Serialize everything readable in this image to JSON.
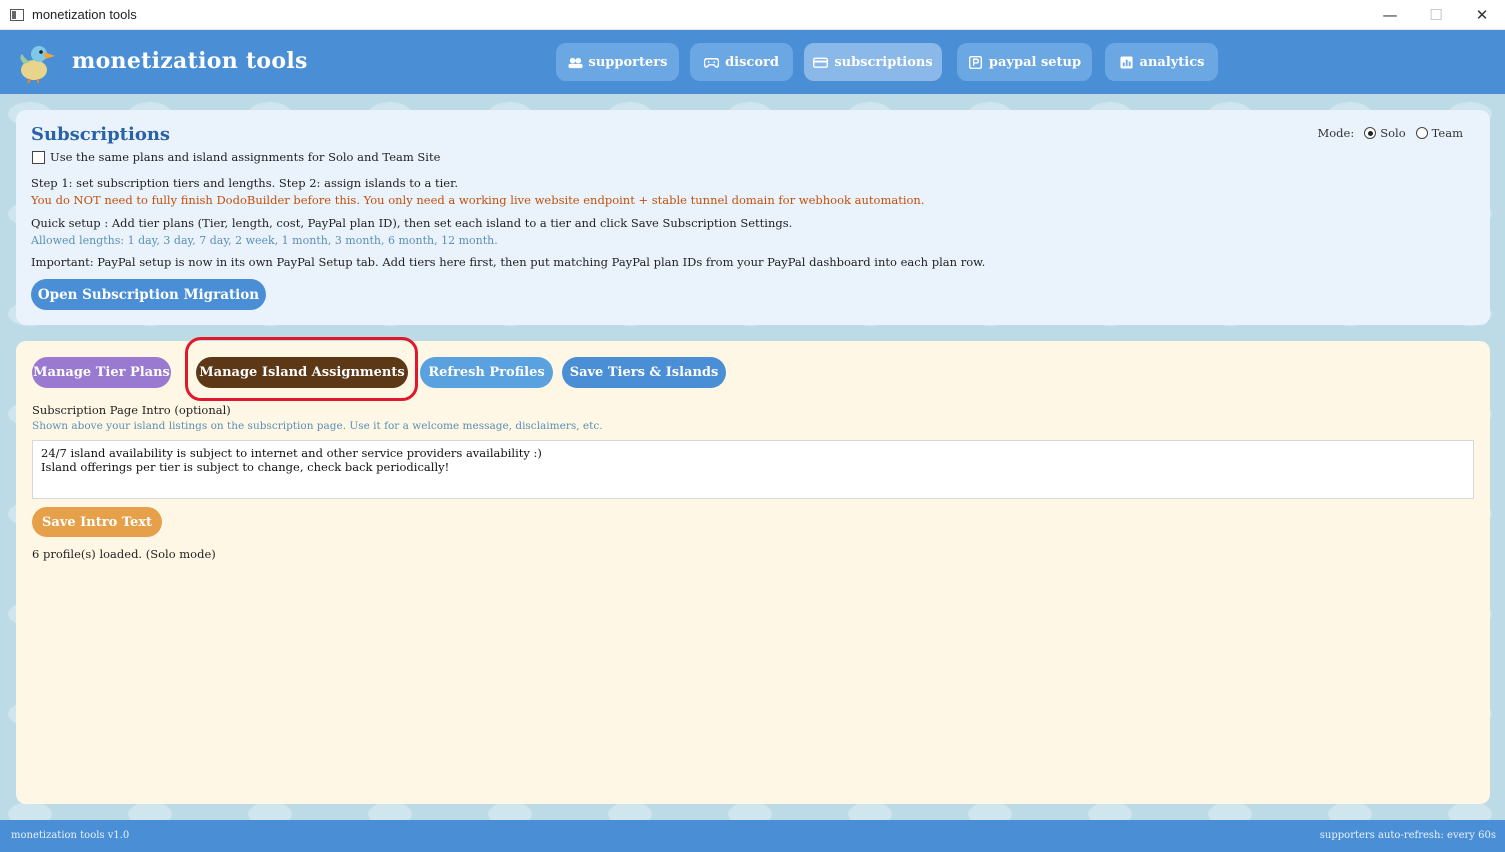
{
  "window": {
    "title": "monetization tools",
    "controls": {
      "minimize": "—",
      "maximize": "☐",
      "close": "✕"
    }
  },
  "header": {
    "brand": "monetization tools",
    "logo_icon": "dodo-bird-icon",
    "nav": [
      {
        "label": "supporters",
        "icon": "users-icon",
        "active": false
      },
      {
        "label": "discord",
        "icon": "gamepad-icon",
        "active": false
      },
      {
        "label": "subscriptions",
        "icon": "card-icon",
        "active": true
      },
      {
        "label": "paypal setup",
        "icon": "paypal-icon",
        "active": false
      },
      {
        "label": "analytics",
        "icon": "chart-icon",
        "active": false
      }
    ]
  },
  "subscriptions": {
    "title": "Subscriptions",
    "same_plans_label": "Use the same plans and island assignments for Solo and Team Site",
    "same_plans_checked": false,
    "mode_label": "Mode:",
    "mode_options": [
      "Solo",
      "Team"
    ],
    "mode_selected": "Solo",
    "step_text": "Step 1: set subscription tiers and lengths. Step 2: assign islands to a tier.",
    "warning_text": "You do NOT need to fully finish DodoBuilder before this. You only need a working live website endpoint + stable tunnel domain for webhook automation.",
    "quick_setup_text": "Quick setup : Add tier plans (Tier, length, cost, PayPal plan ID), then set each island to a tier and click Save Subscription Settings.",
    "allowed_lengths_text": "Allowed lengths: 1 day, 3 day, 7 day, 2 week, 1 month, 3 month, 6 month, 12 month.",
    "important_text": "Important:  PayPal setup is now in its own PayPal Setup tab. Add tiers here first, then put matching PayPal plan IDs from your PayPal dashboard into each plan row.",
    "migration_button": "Open Subscription Migration"
  },
  "actions": {
    "manage_tier_plans": "Manage Tier Plans",
    "manage_island_assignments": "Manage Island Assignments",
    "refresh_profiles": "Refresh Profiles",
    "save_tiers_islands": "Save Tiers & Islands"
  },
  "intro": {
    "label": "Subscription Page Intro (optional)",
    "help": "Shown above your island listings on the subscription page. Use it for a welcome message, disclaimers, etc.",
    "line1": "24/7 island availability is subject to internet and other service providers availability :)",
    "line2": "Island offerings per tier is subject to change, check back periodically!",
    "save_button": "Save Intro Text"
  },
  "status_text": "6 profile(s) loaded. (Solo mode)",
  "footer": {
    "version": "monetization tools v1.0",
    "refresh_note": "supporters auto-refresh: every 60s"
  },
  "colors": {
    "header_blue": "#4a8fd6",
    "highlight_red": "#e0182d",
    "warning_orange": "#c0500c",
    "active_button_brown": "#5c3817"
  }
}
